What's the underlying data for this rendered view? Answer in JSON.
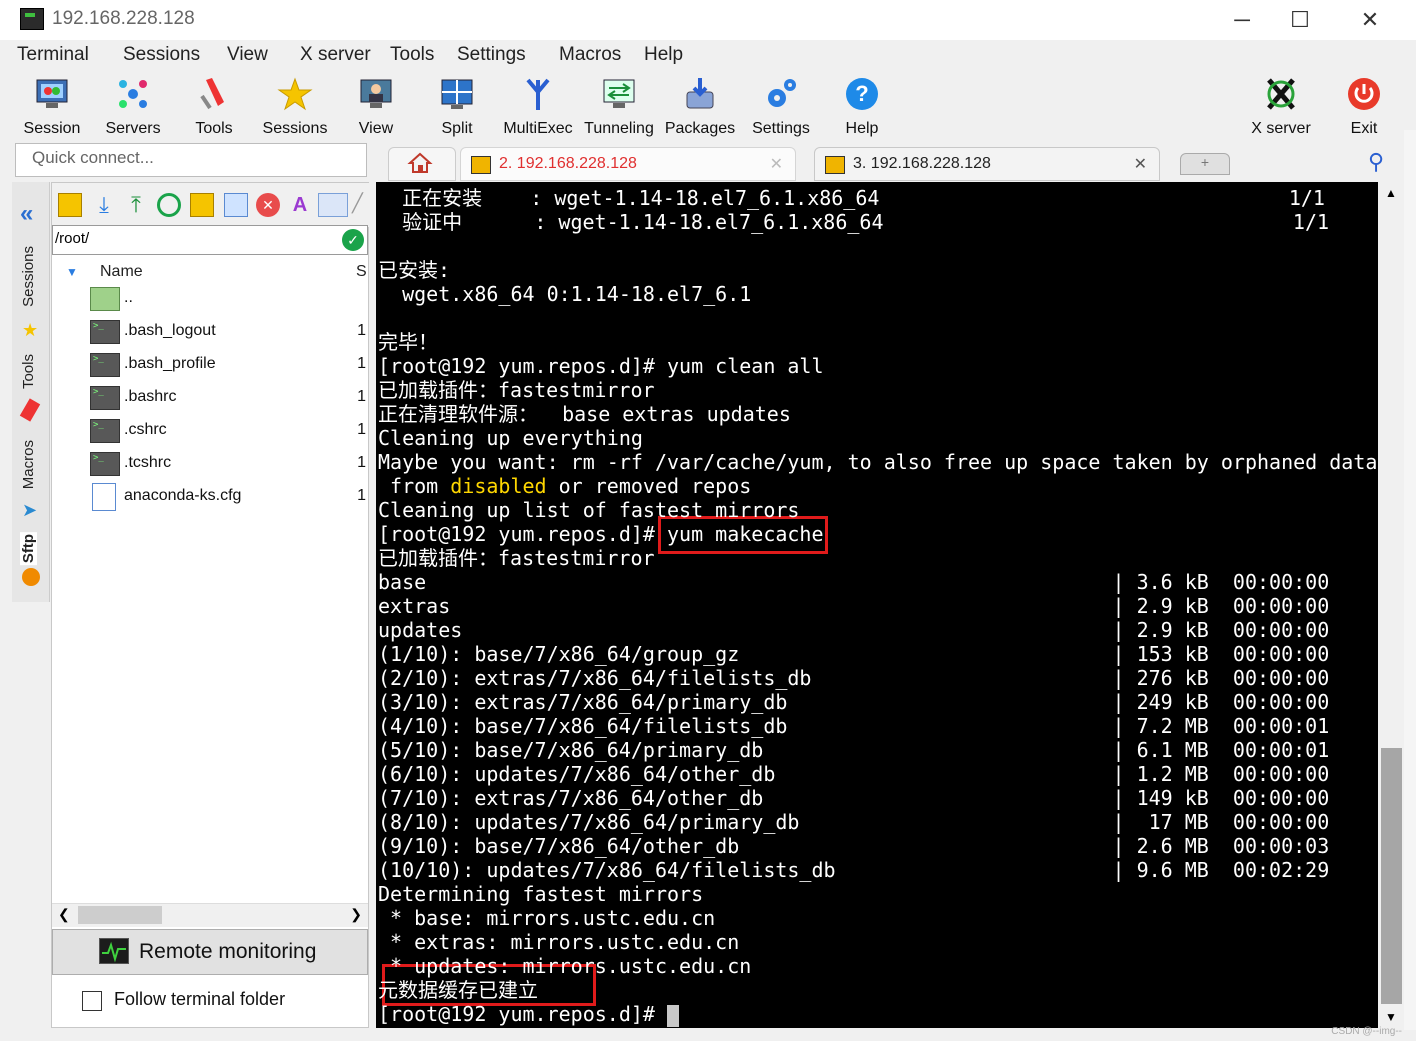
{
  "window": {
    "title": "192.168.228.128",
    "minimize": "─",
    "maximize": "☐",
    "close": "✕"
  },
  "menu": [
    "Terminal",
    "Sessions",
    "View",
    "X server",
    "Tools",
    "Settings",
    "Macros",
    "Help"
  ],
  "toolbar": {
    "session": "Session",
    "servers": "Servers",
    "tools": "Tools",
    "sessions": "Sessions",
    "view": "View",
    "split": "Split",
    "multiexec": "MultiExec",
    "tunneling": "Tunneling",
    "packages": "Packages",
    "settings": "Settings",
    "help": "Help",
    "xserver": "X server",
    "exit": "Exit"
  },
  "quick_connect": {
    "placeholder": "Quick connect..."
  },
  "tabs": [
    {
      "label": "2. 192.168.228.128",
      "color": "#e03030"
    },
    {
      "label": "3. 192.168.228.128",
      "color": "#222222"
    }
  ],
  "side_tabs": {
    "sessions": "Sessions",
    "tools": "Tools",
    "macros": "Macros",
    "sftp": "Sftp"
  },
  "sftp": {
    "path": "/root/",
    "columns": {
      "name": "Name",
      "size": "S"
    },
    "files": [
      {
        "name": "..",
        "size": ""
      },
      {
        "name": ".bash_logout",
        "size": "1"
      },
      {
        "name": ".bash_profile",
        "size": "1"
      },
      {
        "name": ".bashrc",
        "size": "1"
      },
      {
        "name": ".cshrc",
        "size": "1"
      },
      {
        "name": ".tcshrc",
        "size": "1"
      },
      {
        "name": "anaconda-ks.cfg",
        "size": "1"
      }
    ],
    "remote_monitoring": "Remote monitoring",
    "follow_terminal": "Follow terminal folder"
  },
  "terminal": {
    "lines": [
      "  正在安装    : wget-1.14-18.el7_6.1.x86_64                                  1/1",
      "  验证中      : wget-1.14-18.el7_6.1.x86_64                                  1/1",
      "",
      "已安装:",
      "  wget.x86_64 0:1.14-18.el7_6.1",
      "",
      "完毕！",
      "[root@192 yum.repos.d]# yum clean all",
      "已加载插件：fastestmirror",
      "正在清理软件源：  base extras updates",
      "Cleaning up everything",
      "Maybe you want: rm -rf /var/cache/yum, to also free up space taken by orphaned data",
      " from disabled or removed repos",
      "Cleaning up list of fastest mirrors",
      "[root@192 yum.repos.d]# yum makecache",
      "已加载插件：fastestmirror",
      "base                                                         | 3.6 kB  00:00:00",
      "extras                                                       | 2.9 kB  00:00:00",
      "updates                                                      | 2.9 kB  00:00:00",
      "(1/10): base/7/x86_64/group_gz                               | 153 kB  00:00:00",
      "(2/10): extras/7/x86_64/filelists_db                         | 276 kB  00:00:00",
      "(3/10): extras/7/x86_64/primary_db                           | 249 kB  00:00:00",
      "(4/10): base/7/x86_64/filelists_db                           | 7.2 MB  00:00:01",
      "(5/10): base/7/x86_64/primary_db                             | 6.1 MB  00:00:01",
      "(6/10): updates/7/x86_64/other_db                            | 1.2 MB  00:00:00",
      "(7/10): extras/7/x86_64/other_db                             | 149 kB  00:00:00",
      "(8/10): updates/7/x86_64/primary_db                          |  17 MB  00:00:00",
      "(9/10): base/7/x86_64/other_db                               | 2.6 MB  00:00:03",
      "(10/10): updates/7/x86_64/filelists_db                       | 9.6 MB  00:02:29",
      "Determining fastest mirrors",
      " * base: mirrors.ustc.edu.cn",
      " * extras: mirrors.ustc.edu.cn",
      " * updates: mirrors.ustc.edu.cn",
      "元数据缓存已建立",
      "[root@192 yum.repos.d]# "
    ],
    "highlight_word": "disabled",
    "highlight_color": "#ffd700"
  },
  "watermark": "CSDN @--img--"
}
